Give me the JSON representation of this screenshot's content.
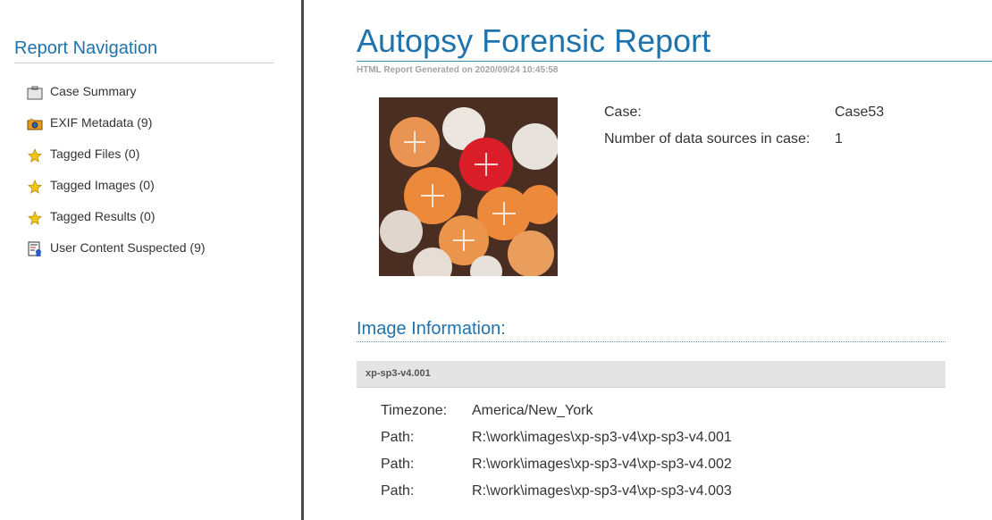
{
  "sidebar": {
    "title": "Report Navigation",
    "items": [
      {
        "label": "Case Summary",
        "icon": "briefcase-icon"
      },
      {
        "label": "EXIF Metadata (9)",
        "icon": "camera-icon"
      },
      {
        "label": "Tagged Files (0)",
        "icon": "star-icon"
      },
      {
        "label": "Tagged Images (0)",
        "icon": "star-icon"
      },
      {
        "label": "Tagged Results (0)",
        "icon": "star-icon"
      },
      {
        "label": "User Content Suspected (9)",
        "icon": "user-content-icon"
      }
    ]
  },
  "header": {
    "title": "Autopsy Forensic Report",
    "generated": "HTML Report Generated on 2020/09/24 10:45:58"
  },
  "case_info": {
    "rows": [
      {
        "label": "Case:",
        "value": "Case53"
      },
      {
        "label": "Number of data sources in case:",
        "value": "1"
      }
    ]
  },
  "image_info": {
    "heading": "Image Information:",
    "image_name": "xp-sp3-v4.001",
    "rows": [
      {
        "label": "Timezone:",
        "value": "America/New_York"
      },
      {
        "label": "Path:",
        "value": "R:\\work\\images\\xp-sp3-v4\\xp-sp3-v4.001"
      },
      {
        "label": "Path:",
        "value": "R:\\work\\images\\xp-sp3-v4\\xp-sp3-v4.002"
      },
      {
        "label": "Path:",
        "value": "R:\\work\\images\\xp-sp3-v4\\xp-sp3-v4.003"
      }
    ]
  },
  "colors": {
    "accent": "#1f73ad",
    "divider": "#4a4a4a",
    "bar": "#e4e4e4"
  }
}
